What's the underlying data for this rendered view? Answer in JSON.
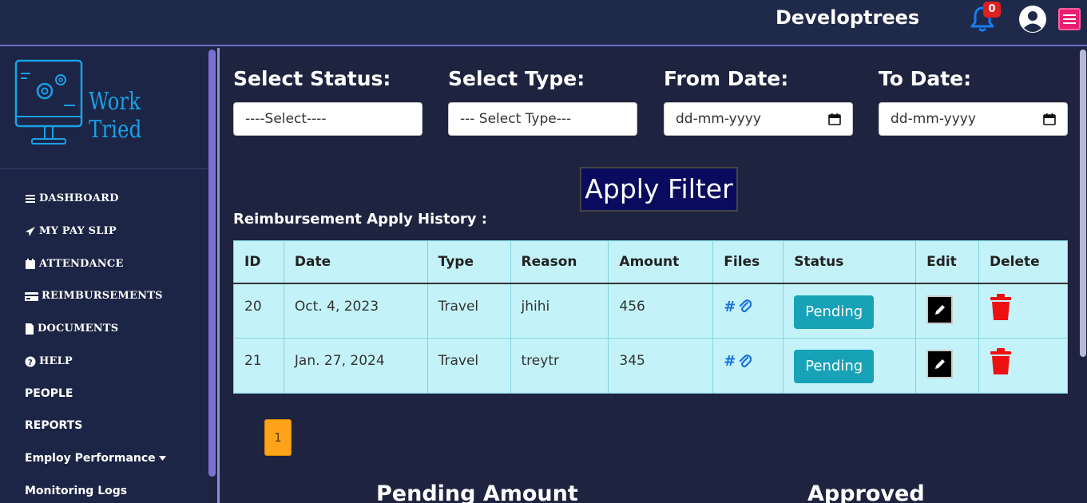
{
  "header": {
    "brand": "Developtrees",
    "notification_count": "0"
  },
  "sidebar": {
    "logo_text": "Work Tried",
    "items": [
      {
        "label": "DASHBOARD",
        "icon": "bars-icon"
      },
      {
        "label": "MY PAY SLIP",
        "icon": "paper-plane-icon"
      },
      {
        "label": "ATTENDANCE",
        "icon": "calendar-icon"
      },
      {
        "label": "REIMBURSEMENTS",
        "icon": "credit-card-icon"
      },
      {
        "label": "DOCUMENTS",
        "icon": "file-icon"
      },
      {
        "label": "HELP",
        "icon": "question-circle-icon"
      },
      {
        "label": "PEOPLE"
      },
      {
        "label": "REPORTS"
      },
      {
        "label": "Employ Performance"
      },
      {
        "label": "Monitoring Logs"
      }
    ]
  },
  "filters": {
    "status_label": "Select Status:",
    "status_value": "----Select----",
    "type_label": "Select Type:",
    "type_value": "--- Select Type---",
    "from_label": "From Date:",
    "from_placeholder": "dd-mm-yyyy",
    "to_label": "To Date:",
    "to_placeholder": "dd-mm-yyyy",
    "apply_label": "Apply Filter"
  },
  "history": {
    "title": "Reimbursement Apply History :",
    "columns": [
      "ID",
      "Date",
      "Type",
      "Reason",
      "Amount",
      "Files",
      "Status",
      "Edit",
      "Delete"
    ],
    "rows": [
      {
        "id": "20",
        "date": "Oct. 4, 2023",
        "type": "Travel",
        "reason": "jhihi",
        "amount": "456",
        "files": "#",
        "status": "Pending"
      },
      {
        "id": "21",
        "date": "Jan. 27, 2024",
        "type": "Travel",
        "reason": "treytr",
        "amount": "345",
        "files": "#",
        "status": "Pending"
      }
    ]
  },
  "pagination": {
    "current": "1"
  },
  "summary": {
    "pending_label": "Pending Amount",
    "approved_label": "Approved"
  },
  "colors": {
    "background": "#1e2440",
    "table_bg": "#c3f3f9",
    "status_badge": "#17a2b8",
    "page_button": "#ffa31a",
    "delete": "#ee1111"
  }
}
